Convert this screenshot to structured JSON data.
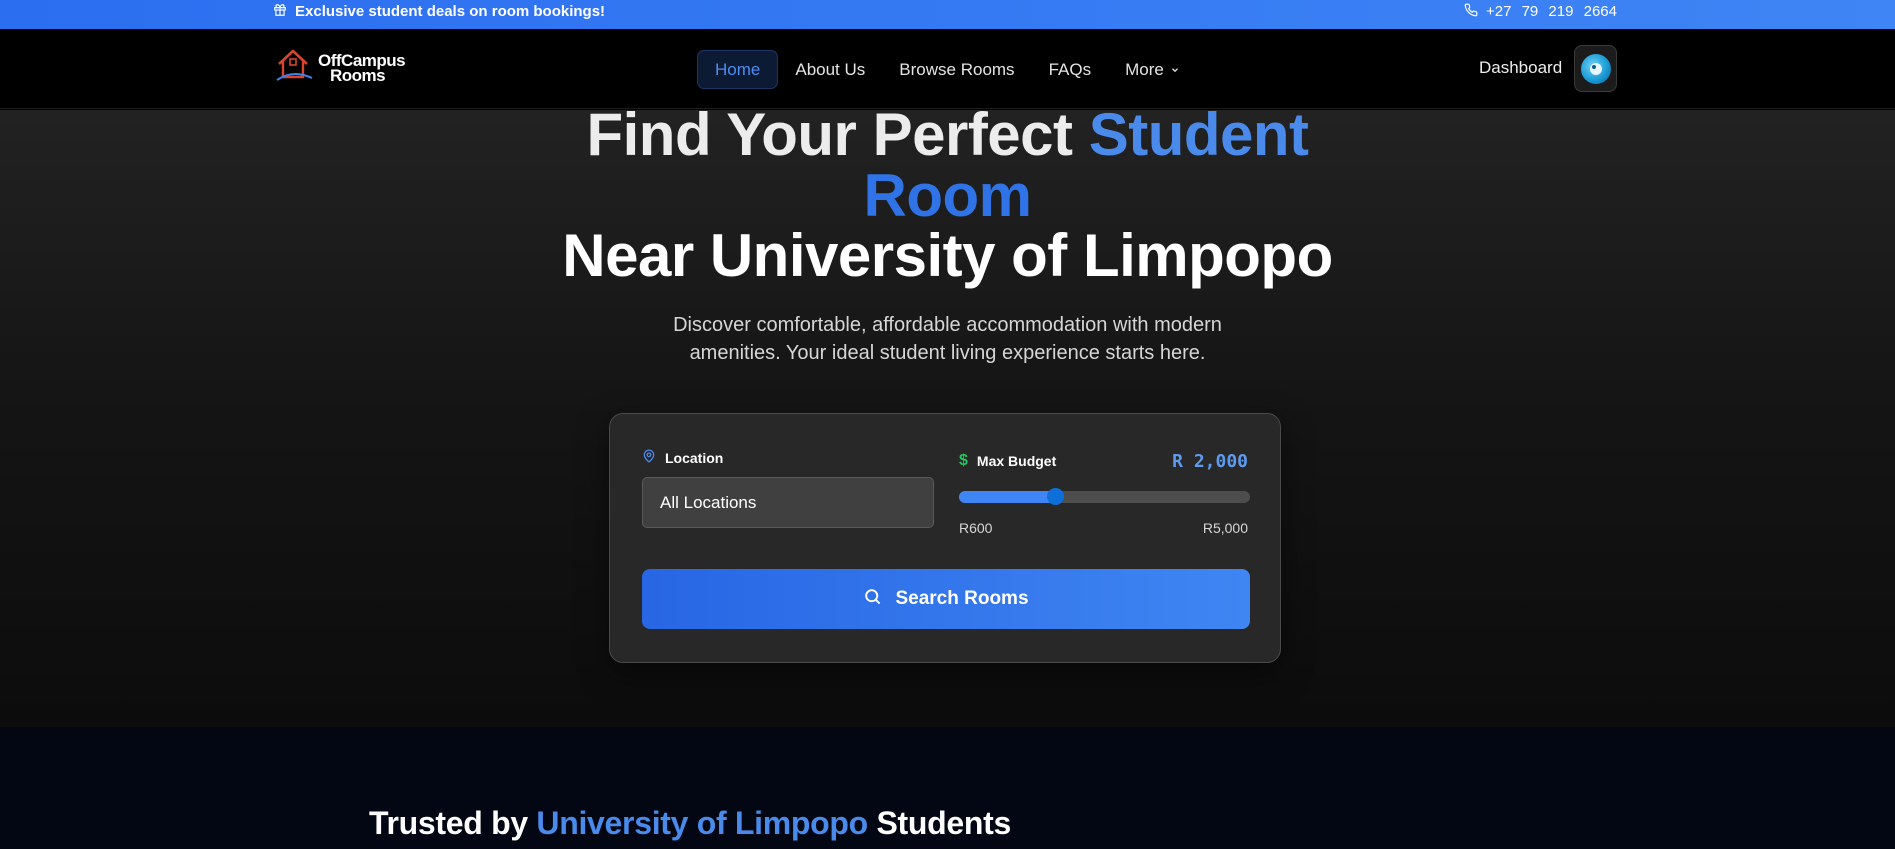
{
  "topbar": {
    "promo_text": "Exclusive student deals on room bookings!",
    "phone": "+27 79 219 2664"
  },
  "brand": {
    "line1": "OffCampus",
    "line2": "Rooms"
  },
  "nav": {
    "items": [
      {
        "label": "Home",
        "active": true
      },
      {
        "label": "About Us"
      },
      {
        "label": "Browse Rooms"
      },
      {
        "label": "FAQs"
      },
      {
        "label": "More"
      }
    ],
    "dashboard_label": "Dashboard"
  },
  "hero": {
    "title_part1": "Find Your Perfect ",
    "title_highlight_1": "Student",
    "title_highlight_2": "Room",
    "title_line3": "Near University of Limpopo",
    "subtitle_line1": "Discover comfortable, affordable accommodation with modern",
    "subtitle_line2": "amenities. Your ideal student living experience starts here."
  },
  "search": {
    "location_label": "Location",
    "location_value": "All Locations",
    "budget_label": "Max Budget",
    "budget_value": "R 2,000",
    "budget_min": "R600",
    "budget_max": "R5,000",
    "budget_fraction": 0.33,
    "button_label": "Search Rooms"
  },
  "trusted": {
    "prefix": "Trusted by ",
    "highlight": "University of Limpopo",
    "suffix": " Students"
  },
  "colors": {
    "accent": "#3d82ea",
    "topbar": "#2b6ef0",
    "budget_icon": "#22c55e"
  }
}
